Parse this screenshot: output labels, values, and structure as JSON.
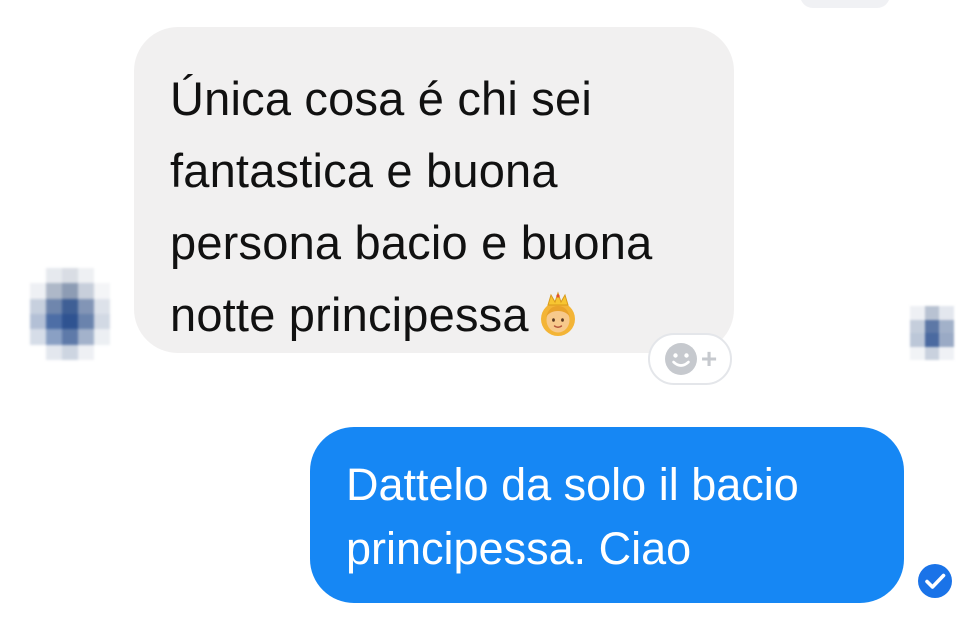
{
  "conversation": {
    "incoming_message": {
      "lines": [
        "Única cosa é chi sei",
        "fantastica e buona",
        "persona bacio e buona",
        "notte principessa"
      ],
      "emoji": "princess-emoji"
    },
    "reaction_button": {
      "icon": "smiley-icon",
      "plus": "+"
    },
    "outgoing_message": {
      "lines": [
        "Dattelo da solo il bacio",
        "principessa. Ciao"
      ]
    },
    "status_icon": "delivered-check-icon"
  },
  "colors": {
    "incoming_bubble": "#f1f0f0",
    "outgoing_bubble": "#1687f4",
    "status_icon": "#1a73e8",
    "reaction_border": "#e4e6ea",
    "reaction_icon": "#c6c9ce"
  }
}
